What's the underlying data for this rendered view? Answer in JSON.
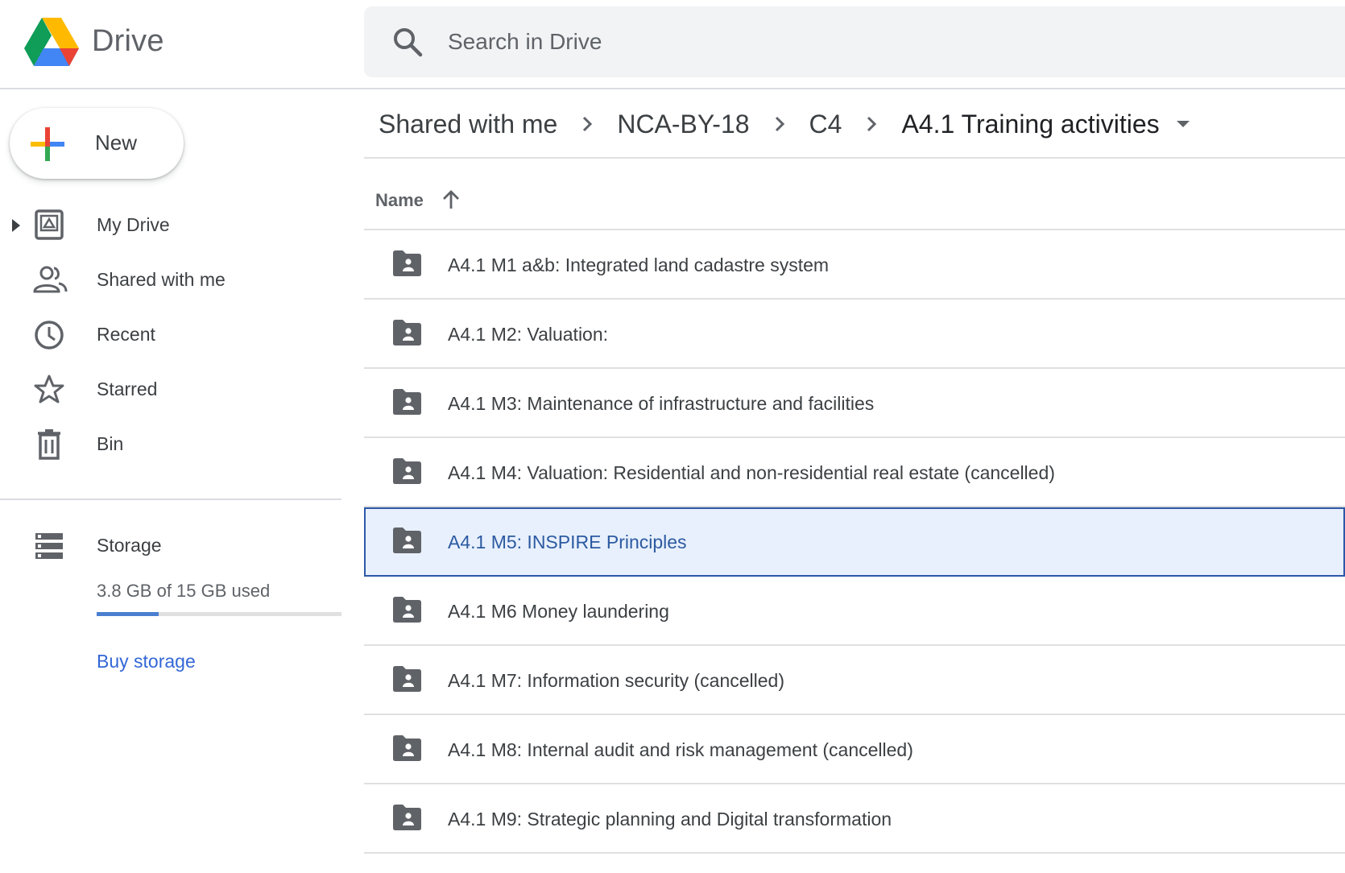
{
  "app": {
    "name": "Drive",
    "colors": {
      "accent": "#1a73e8",
      "selected_bg": "#e8f0fe",
      "selected_border": "#2c58a8",
      "link": "#3367d6"
    }
  },
  "search": {
    "placeholder": "Search in Drive",
    "icon": "search-icon"
  },
  "new_button": {
    "label": "New",
    "icon": "multicolor-plus-icon"
  },
  "sidebar": {
    "items": [
      {
        "label": "My Drive",
        "icon": "my-drive-icon",
        "expandable": true
      },
      {
        "label": "Shared with me",
        "icon": "people-icon"
      },
      {
        "label": "Recent",
        "icon": "clock-icon"
      },
      {
        "label": "Starred",
        "icon": "star-icon"
      },
      {
        "label": "Bin",
        "icon": "trash-icon"
      }
    ],
    "storage": {
      "label": "Storage",
      "icon": "storage-icon",
      "used_text": "3.8 GB of 15 GB used",
      "used_fraction": 0.253,
      "buy_label": "Buy storage"
    }
  },
  "breadcrumb": {
    "items": [
      "Shared with me",
      "NCA-BY-18",
      "C4",
      "A4.1 Training activities"
    ]
  },
  "list": {
    "column_header": "Name",
    "sort": "ascending",
    "rows": [
      {
        "name": "A4.1 M1 a&b: Integrated land cadastre system",
        "type": "shared-folder"
      },
      {
        "name": "A4.1 M2: Valuation:",
        "type": "shared-folder"
      },
      {
        "name": "A4.1 M3: Maintenance of infrastructure and facilities",
        "type": "shared-folder"
      },
      {
        "name": "A4.1 M4: Valuation: Residential and non-residential real estate (cancelled)",
        "type": "shared-folder"
      },
      {
        "name": "A4.1 M5: INSPIRE Principles",
        "type": "shared-folder",
        "selected": true
      },
      {
        "name": "A4.1 M6 Money laundering",
        "type": "shared-folder"
      },
      {
        "name": "A4.1 M7: Information security (cancelled)",
        "type": "shared-folder"
      },
      {
        "name": "A4.1 M8: Internal audit and risk management (cancelled)",
        "type": "shared-folder"
      },
      {
        "name": "A4.1 M9: Strategic planning and Digital transformation",
        "type": "shared-folder"
      }
    ]
  }
}
